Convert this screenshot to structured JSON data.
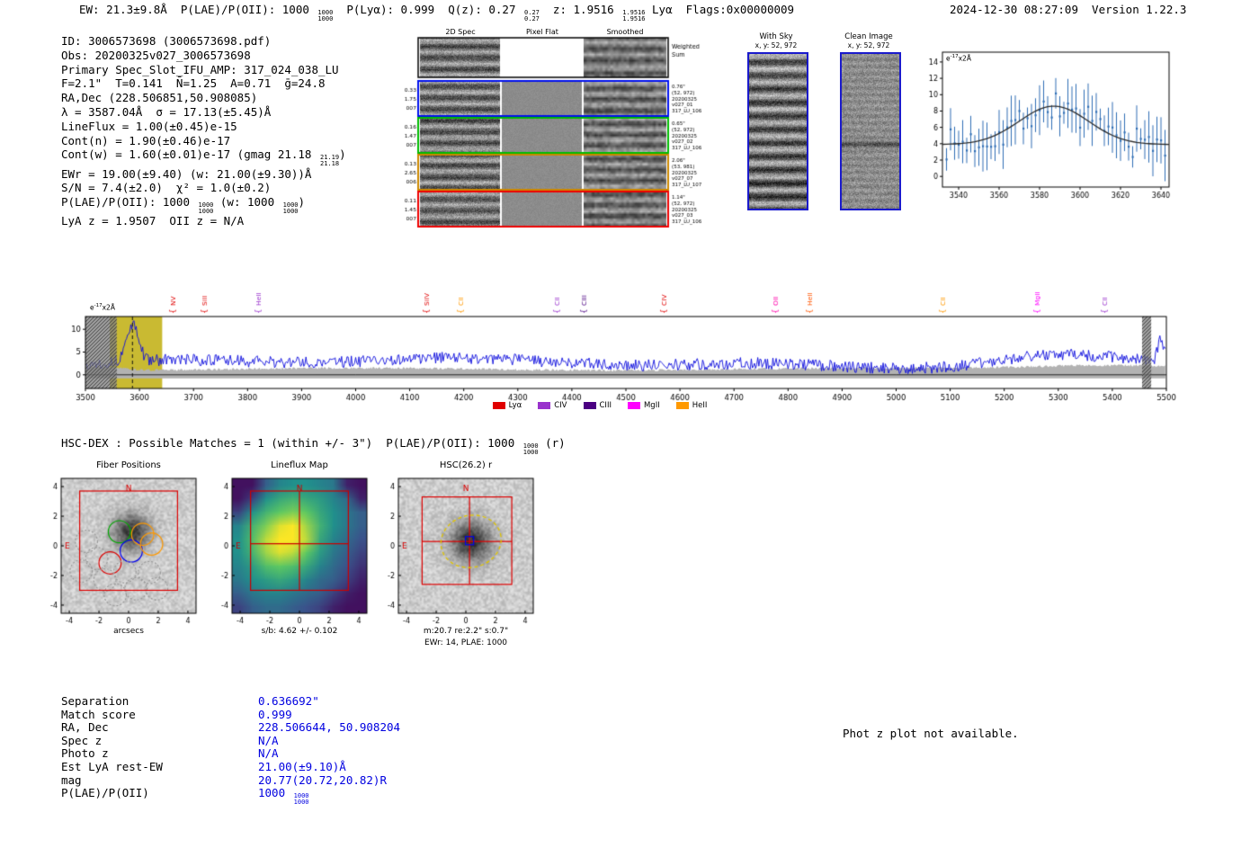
{
  "header": {
    "ew": "EW: 21.3±9.8Å  ",
    "plae_label": "P(LAE)/P(OII): ",
    "plae_value": "1000 ",
    "plae_top": "1000",
    "plae_bot": "1000",
    "plya": "  P(Lyα): 0.999  ",
    "qz_label": "Q(z): ",
    "qz_value": "0.27 ",
    "qz_top": "0.27",
    "qz_bot": "0.27",
    "z_label": "  z: ",
    "z_value": "1.9516 ",
    "z_top": "1.9516",
    "z_bot": "1.9516",
    "line_id": " Lyα  ",
    "flags": "Flags:0x00000009",
    "timestamp": "2024-12-30 08:27:09  Version 1.22.3"
  },
  "info": {
    "id": "ID: 3006573698 (3006573698.pdf)",
    "obs": "Obs: 20200325v027_3006573698",
    "slot": "Primary Spec_Slot_IFU_AMP: 317_024_038_LU",
    "seeing": "F=2.1\"  T=0.141  N̄=1.25  A=0.71  ḡ=24.8",
    "radec": "RA,Dec (228.506851,50.908085)",
    "wave": "λ = 3587.04Å  σ = 17.13(±5.45)Å",
    "lineflux": "LineFlux = 1.00(±0.45)e-15",
    "cont_n": "Cont(n) = 1.90(±0.46)e-17",
    "cont_w_pre": "Cont(w) = 1.60(±0.01)e-17 (gmag 21.18 ",
    "cont_w_top": "21.19",
    "cont_w_bot": "21.18",
    "cont_w_post": ")",
    "ewr": "EWr = 19.00(±9.40) (w: 21.00(±9.30))Å",
    "sn": "S/N = 7.4(±2.0)  χ² = 1.0(±0.2)",
    "plae_pre": "P(LAE)/P(OII): 1000 ",
    "plae_top1": "1000",
    "plae_bot1": "1000",
    "plae_mid": " (w: 1000 ",
    "plae_top2": "1000",
    "plae_bot2": "1000",
    "plae_post": ")",
    "lya_z": "LyA z = 1.9507  OII z = N/A"
  },
  "spec2d": {
    "headers": [
      "2D Spec",
      "Pixel Flat",
      "Smoothed"
    ],
    "weighted_sum": [
      "Weighted",
      "Sum"
    ],
    "rows": [
      {
        "border": "#000000",
        "left": [],
        "right": []
      },
      {
        "border": "#0010ee",
        "left": [
          "0.33",
          "1.75",
          "007"
        ],
        "right": [
          "0.76\"",
          "(52, 972)",
          "20200325",
          "v027_01",
          "317_LU_106"
        ]
      },
      {
        "border": "#00bb00",
        "left": [
          "0.16",
          "1.47",
          "007"
        ],
        "right": [
          "0.65\"",
          "(52, 972)",
          "20200325",
          "v027_02",
          "317_LU_106"
        ]
      },
      {
        "border": "#cc8800",
        "left": [
          "0.13",
          "2.65",
          "006"
        ],
        "right": [
          "2.06\"",
          "(53, 981)",
          "20200325",
          "v027_07",
          "317_LU_107"
        ]
      },
      {
        "border": "#ee0000",
        "left": [
          "0.11",
          "1.45",
          "007"
        ],
        "right": [
          "1.14\"",
          "(52, 972)",
          "20200325",
          "v027_03",
          "317_LU_106"
        ]
      }
    ]
  },
  "calib": {
    "with_sky": {
      "title": "With Sky",
      "xy": "x, y: 52, 972"
    },
    "clean": {
      "title": "Clean Image",
      "xy": "x, y: 52, 972"
    }
  },
  "hsc_line": {
    "pre": "HSC-DEX : Possible Matches = 1 (within +/- 3\")  P(LAE)/P(OII): 1000 ",
    "top": "1000",
    "bot": "1000",
    "post": " (r)"
  },
  "match_table": {
    "rows": [
      {
        "label": "Separation",
        "value": "0.636692\""
      },
      {
        "label": "Match score",
        "value": "0.999"
      },
      {
        "label": "RA, Dec",
        "value": "228.506644, 50.908204"
      },
      {
        "label": "Spec z",
        "value": "N/A"
      },
      {
        "label": "Photo z",
        "value": "N/A"
      },
      {
        "label": "Est LyA rest-EW",
        "value": "21.00(±9.10)Å"
      },
      {
        "label": "mag",
        "value": "20.77(20.72,20.82)R"
      },
      {
        "label": "P(LAE)/P(OII)",
        "value": "1000 ",
        "value_top": "1000",
        "value_bot": "1000"
      }
    ]
  },
  "phot_z_note": "Phot z plot not available.",
  "chart_data": [
    {
      "id": "line-fit-plot",
      "type": "scatter",
      "title": "",
      "ylabel": {
        "prefix": "e",
        "sup": "-17",
        "suffix": "x2Å"
      },
      "xlim": [
        3532,
        3644
      ],
      "ylim": [
        -1.3,
        15.2
      ],
      "xticks": [
        3540,
        3560,
        3580,
        3600,
        3620,
        3640
      ],
      "yticks": [
        0,
        2,
        4,
        6,
        8,
        10,
        12,
        14
      ],
      "fit": {
        "center": 3587.04,
        "sigma": 17.13,
        "baseline": 3.9,
        "peak": 8.6
      },
      "points": {
        "x_start": 3534,
        "x_end": 3642,
        "step": 2,
        "noise": 1.9,
        "err": 2.1,
        "seed": 7
      },
      "colors": {
        "points": "#2e6db4",
        "fit": "#2a2a2a"
      }
    },
    {
      "id": "full-spectrum",
      "type": "line",
      "ylabel": {
        "prefix": "e",
        "sup": "-17",
        "suffix": "x2Å"
      },
      "xlim": [
        3500,
        5500
      ],
      "ylim": [
        -3,
        12.8
      ],
      "xticks": [
        3500,
        3600,
        3700,
        3800,
        3900,
        4000,
        4100,
        4200,
        4300,
        4400,
        4500,
        4600,
        4700,
        4800,
        4900,
        5000,
        5100,
        5200,
        5300,
        5400,
        5500
      ],
      "yticks": [
        0,
        5,
        10
      ],
      "line_color": "#0b0bdc",
      "err_color": "#b2b2b2",
      "highlight": {
        "x0": 3545,
        "x1": 3642,
        "color": "#c3b21c"
      },
      "hatch_bands": [
        [
          3500,
          3558
        ],
        [
          5455,
          5472
        ]
      ],
      "center_line": 3587,
      "seed": 13,
      "peak": {
        "center": 3587,
        "sigma": 11,
        "amp": 8.0
      },
      "emission_lines": [
        {
          "label": "NV",
          "wave": 3662,
          "color": "#e00000"
        },
        {
          "label": "SiII",
          "wave": 3720,
          "color": "#e00000"
        },
        {
          "label": "HeII",
          "wave": 3820,
          "color": "#9932cc"
        },
        {
          "label": "SiIV",
          "wave": 4131,
          "color": "#e00000"
        },
        {
          "label": "CII",
          "wave": 4195,
          "color": "#ff9900"
        },
        {
          "label": "CII",
          "wave": 4372,
          "color": "#9932cc"
        },
        {
          "label": "CIII",
          "wave": 4422,
          "color": "#4b0082"
        },
        {
          "label": "CIV",
          "wave": 4571,
          "color": "#e00000"
        },
        {
          "label": "OII",
          "wave": 4777,
          "color": "#ff00aa"
        },
        {
          "label": "HeII",
          "wave": 4840,
          "color": "#ff5500"
        },
        {
          "label": "CII",
          "wave": 5087,
          "color": "#ff9900"
        },
        {
          "label": "MgII",
          "wave": 5262,
          "color": "#ff00ff"
        },
        {
          "label": "CII",
          "wave": 5386,
          "color": "#9932cc"
        }
      ],
      "legend": [
        {
          "label": "Lyα",
          "color": "#e00000"
        },
        {
          "label": "CIV",
          "color": "#9932cc"
        },
        {
          "label": "CIII",
          "color": "#4b0082"
        },
        {
          "label": "MgII",
          "color": "#ff00ff"
        },
        {
          "label": "HeII",
          "color": "#ff9900"
        }
      ]
    },
    {
      "id": "fiber-positions",
      "type": "image-cutout",
      "title": "Fiber Positions",
      "xlabel": "arcsecs",
      "extent": 4.55,
      "ticks": [
        -4,
        -2,
        0,
        2,
        4
      ],
      "seed": 21,
      "blob": {
        "x": 0.15,
        "y": 1.0,
        "sigma": 0.85,
        "depth": 150
      },
      "box": {
        "x0": -3.3,
        "y0": -3.0,
        "x1": 3.3,
        "y1": 3.7,
        "color": "#dd0000"
      },
      "compass": {
        "n": "N",
        "e": "E",
        "color": "#dd0000"
      },
      "fibers": [
        {
          "x": -0.62,
          "y": 0.95,
          "r": 0.75,
          "color": "#00aa00",
          "dash": false
        },
        {
          "x": 0.18,
          "y": -0.35,
          "r": 0.75,
          "color": "#0000ee",
          "dash": false
        },
        {
          "x": -1.25,
          "y": -1.15,
          "r": 0.75,
          "color": "#dd0000",
          "dash": false
        },
        {
          "x": 1.55,
          "y": 0.12,
          "r": 0.75,
          "color": "#ff9900",
          "dash": false
        },
        {
          "x": 0.95,
          "y": 0.78,
          "r": 0.75,
          "color": "#ff9900",
          "dash": false
        },
        {
          "x": -2.85,
          "y": 0.3,
          "r": 0.75,
          "color": "#999999",
          "dash": true
        },
        {
          "x": -2.15,
          "y": -0.85,
          "r": 0.75,
          "color": "#999999",
          "dash": true
        },
        {
          "x": -3.2,
          "y": -1.7,
          "r": 0.75,
          "color": "#999999",
          "dash": true
        },
        {
          "x": -1.6,
          "y": -2.3,
          "r": 0.75,
          "color": "#999999",
          "dash": true
        },
        {
          "x": -0.25,
          "y": -1.75,
          "r": 0.75,
          "color": "#999999",
          "dash": true
        },
        {
          "x": 0.5,
          "y": -2.9,
          "r": 0.75,
          "color": "#999999",
          "dash": true
        },
        {
          "x": -0.9,
          "y": -3.3,
          "r": 0.75,
          "color": "#999999",
          "dash": true
        },
        {
          "x": 1.4,
          "y": -1.8,
          "r": 0.75,
          "color": "#999999",
          "dash": true
        },
        {
          "x": 1.9,
          "y": -2.9,
          "r": 0.75,
          "color": "#999999",
          "dash": true
        }
      ]
    },
    {
      "id": "lineflux-map",
      "type": "heatmap",
      "title": "Lineflux Map",
      "caption": "s/b: 4.62 +/- 0.102",
      "extent": 4.55,
      "ticks": [
        -4,
        -2,
        0,
        2,
        4
      ],
      "colormap": "viridis",
      "grid": [
        [
          0.05,
          0.05,
          0.3,
          0.45,
          0.5,
          0.5,
          0.45,
          0.4,
          0.1,
          0.05
        ],
        [
          0.05,
          0.2,
          0.5,
          0.6,
          0.65,
          0.6,
          0.55,
          0.45,
          0.35,
          0.1
        ],
        [
          0.2,
          0.5,
          0.65,
          0.75,
          0.8,
          0.75,
          0.6,
          0.5,
          0.4,
          0.3
        ],
        [
          0.45,
          0.65,
          0.8,
          0.95,
          1.0,
          0.85,
          0.65,
          0.5,
          0.4,
          0.3
        ],
        [
          0.5,
          0.7,
          0.9,
          1.0,
          1.0,
          0.9,
          0.6,
          0.45,
          0.35,
          0.25
        ],
        [
          0.5,
          0.65,
          0.85,
          0.95,
          0.9,
          0.75,
          0.55,
          0.4,
          0.3,
          0.2
        ],
        [
          0.45,
          0.55,
          0.7,
          0.75,
          0.7,
          0.6,
          0.45,
          0.35,
          0.25,
          0.15
        ],
        [
          0.4,
          0.5,
          0.55,
          0.6,
          0.55,
          0.45,
          0.35,
          0.3,
          0.2,
          0.1
        ],
        [
          0.3,
          0.4,
          0.45,
          0.45,
          0.4,
          0.35,
          0.3,
          0.2,
          0.1,
          0.05
        ],
        [
          0.2,
          0.3,
          0.35,
          0.35,
          0.3,
          0.25,
          0.2,
          0.1,
          0.05,
          0.05
        ]
      ],
      "crosshair": {
        "x": 0.0,
        "y": 0.15,
        "color": "#cc0000"
      },
      "box": {
        "x0": -3.3,
        "y0": -3.0,
        "x1": 3.3,
        "y1": 3.7,
        "color": "#cc0000"
      },
      "compass": {
        "n": "N",
        "e": "E",
        "color": "#cc0000"
      }
    },
    {
      "id": "hsc-cutout",
      "type": "image-cutout",
      "title": "HSC(26.2) r",
      "captions": [
        "m:20.7 re:2.2\" s:0.7\"",
        "EWr: 14, PLAE: 1000"
      ],
      "extent": 4.55,
      "ticks": [
        -4,
        -2,
        0,
        2,
        4
      ],
      "seed": 33,
      "blob": {
        "x": 0.3,
        "y": 0.35,
        "sigma": 0.95,
        "depth": 160
      },
      "box": {
        "x0": -2.95,
        "y0": -2.6,
        "x1": 3.1,
        "y1": 3.3,
        "color": "#dd0000"
      },
      "crosshair": {
        "x": 0.25,
        "y": 0.3,
        "color": "#dd0000"
      },
      "ellipse": {
        "x": 0.35,
        "y": 0.3,
        "rx": 2.05,
        "ry": 1.75,
        "angle": -15,
        "color": "#e0c400",
        "dash": true
      },
      "square": {
        "x": 0.25,
        "y": 0.35,
        "size": 0.55,
        "color": "#0000ee"
      },
      "compass": {
        "n": "N",
        "e": "E",
        "color": "#dd0000"
      }
    }
  ]
}
